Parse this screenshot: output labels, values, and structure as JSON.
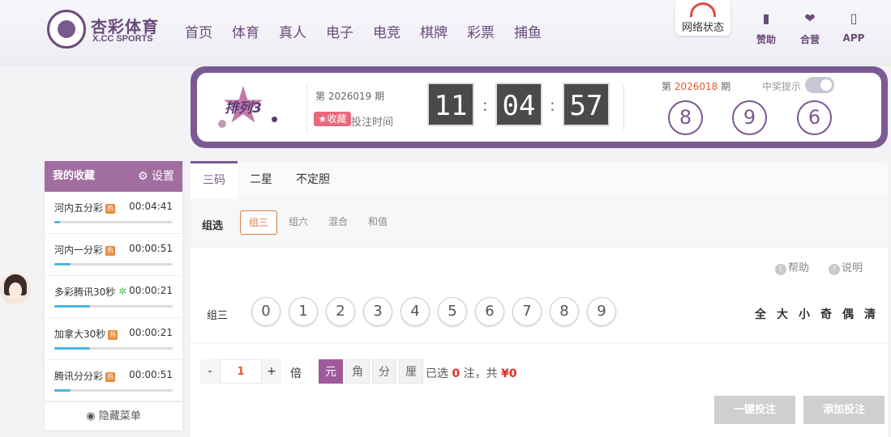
{
  "brand": {
    "name": "杏彩体育",
    "sub": "X.CC SPORTS"
  },
  "nav": [
    "首页",
    "体育",
    "真人",
    "电子",
    "电竞",
    "棋牌",
    "彩票",
    "捕鱼"
  ],
  "network": {
    "label": "网络状态"
  },
  "header_icons": [
    {
      "icon": "bookmark-icon",
      "label": "赞助"
    },
    {
      "icon": "handshake-icon",
      "label": "合营"
    },
    {
      "icon": "phone-icon",
      "label": "APP"
    }
  ],
  "lottery": {
    "name": "排列3",
    "issue_text": "第 2026019 期",
    "fav_label": "收藏",
    "bet_time_label": "投注时间",
    "countdown": [
      "11",
      "04",
      "57"
    ],
    "prev_prefix": "第 ",
    "prev_issue": "2026018",
    "prev_suffix": " 期",
    "notify_label": "中奖提示",
    "results": [
      "8",
      "9",
      "6"
    ]
  },
  "sidebar": {
    "title": "我的收藏",
    "settings": "设置",
    "items": [
      {
        "name": "河内五分彩",
        "badge": "热",
        "time": "00:04:41",
        "progress": 0.05
      },
      {
        "name": "河内一分彩",
        "badge": "热",
        "time": "00:00:51",
        "progress": 0.14
      },
      {
        "name": "多彩腾讯30秒",
        "badge": "✲",
        "time": "00:00:21",
        "progress": 0.3
      },
      {
        "name": "加拿大30秒",
        "badge": "热",
        "time": "00:00:21",
        "progress": 0.3
      },
      {
        "name": "腾讯分分彩",
        "badge": "热",
        "time": "00:00:51",
        "progress": 0.14
      }
    ],
    "hide_label": "隐藏菜单"
  },
  "tabs": [
    "三码",
    "二星",
    "不定胆"
  ],
  "subtabs": {
    "title": "组选",
    "items": [
      "组三",
      "组六",
      "混合",
      "和值"
    ]
  },
  "links": {
    "help": "帮助",
    "explain": "说明"
  },
  "pick": {
    "label": "组三",
    "numbers": [
      "0",
      "1",
      "2",
      "3",
      "4",
      "5",
      "6",
      "7",
      "8",
      "9"
    ],
    "quick": [
      "全",
      "大",
      "小",
      "奇",
      "偶",
      "清"
    ]
  },
  "bet": {
    "minus": "-",
    "plus": "+",
    "multiplier": "1",
    "mult_label": "倍",
    "units": [
      "元",
      "角",
      "分",
      "厘"
    ],
    "selected_prefix": "已选 ",
    "selected_count": "0",
    "selected_mid": " 注，共 ",
    "amount": "¥0",
    "quick_bet": "一键投注",
    "add_bet": "添加投注"
  }
}
